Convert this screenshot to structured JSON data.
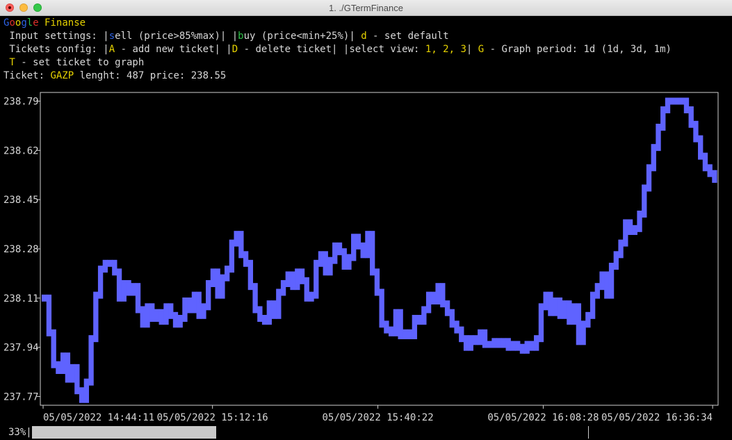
{
  "window": {
    "title": "1. ./GTermFinance"
  },
  "header": {
    "brand": {
      "g1": "G",
      "o1": "o",
      "o2": "o",
      "g2": "g",
      "l": "l",
      "e": "e",
      "rest": " Finanse"
    },
    "input_settings": {
      "prefix": " Input settings: |",
      "s": "s",
      "sell_rest": "ell (price>85%max)| |",
      "b": "b",
      "buy_rest": "uy (price<min+25%)| ",
      "d": "d",
      "d_rest": " - set default"
    },
    "tickets_config": {
      "prefix": " Tickets config: |",
      "a": "A",
      "a_rest": " - add new ticket| |",
      "del": "D",
      "del_rest": " - delete ticket| |select view: ",
      "views": "1, 2, 3",
      "bar": "| ",
      "g": "G",
      "g_rest": " - Graph period: 1d (1d, 3d, 1m)"
    },
    "set_ticket": {
      "t": " T",
      "rest": " - set ticket to graph"
    },
    "ticket_info": {
      "label": "Ticket: ",
      "ticker": "GAZP",
      "rest": " lenght: 487 price: 238.55"
    }
  },
  "chart_data": {
    "type": "line",
    "title": "",
    "ylabel": "",
    "xlabel": "",
    "yticks": [
      "238.79",
      "238.62",
      "238.45",
      "238.28",
      "238.11",
      "237.94",
      "237.77"
    ],
    "xticks": [
      "05/05/2022 14:44:11",
      "05/05/2022 15:12:16",
      "05/05/2022 15:40:22",
      "05/05/2022 16:08:28",
      "05/05/2022 16:36:34"
    ],
    "ylim": [
      237.74,
      238.82
    ],
    "series": [
      {
        "color": "#5f63ff",
        "values": [
          238.11,
          237.99,
          237.88,
          237.86,
          237.91,
          237.83,
          237.87,
          237.79,
          237.76,
          237.82,
          237.97,
          238.12,
          238.21,
          238.23,
          238.23,
          238.2,
          238.11,
          238.16,
          238.13,
          238.15,
          238.07,
          238.02,
          238.08,
          238.04,
          238.06,
          238.03,
          238.08,
          238.05,
          238.02,
          238.04,
          238.1,
          238.07,
          238.12,
          238.05,
          238.08,
          238.16,
          238.2,
          238.12,
          238.18,
          238.21,
          238.3,
          238.33,
          238.26,
          238.23,
          238.15,
          238.07,
          238.04,
          238.03,
          238.09,
          238.05,
          238.13,
          238.16,
          238.19,
          238.15,
          238.2,
          238.17,
          238.11,
          238.12,
          238.23,
          238.26,
          238.2,
          238.24,
          238.29,
          238.27,
          238.22,
          238.25,
          238.32,
          238.29,
          238.26,
          238.33,
          238.2,
          238.13,
          238.02,
          238.0,
          237.99,
          238.06,
          237.98,
          237.99,
          237.98,
          238.04,
          238.03,
          238.07,
          238.12,
          238.1,
          238.15,
          238.09,
          238.06,
          238.02,
          238.0,
          237.97,
          237.94,
          237.97,
          237.96,
          237.99,
          237.95,
          237.95,
          237.96,
          237.95,
          237.96,
          237.94,
          237.95,
          237.94,
          237.93,
          237.95,
          237.94,
          237.97,
          238.08,
          238.12,
          238.06,
          238.1,
          238.05,
          238.09,
          238.03,
          238.08,
          237.96,
          238.02,
          238.05,
          238.12,
          238.15,
          238.19,
          238.12,
          238.22,
          238.26,
          238.3,
          238.37,
          238.34,
          238.35,
          238.4,
          238.49,
          238.56,
          238.63,
          238.7,
          238.76,
          238.79,
          238.79,
          238.79,
          238.79,
          238.76,
          238.71,
          238.66,
          238.6,
          238.56,
          238.54,
          238.52
        ]
      }
    ]
  },
  "status": {
    "percent": "33%|"
  }
}
